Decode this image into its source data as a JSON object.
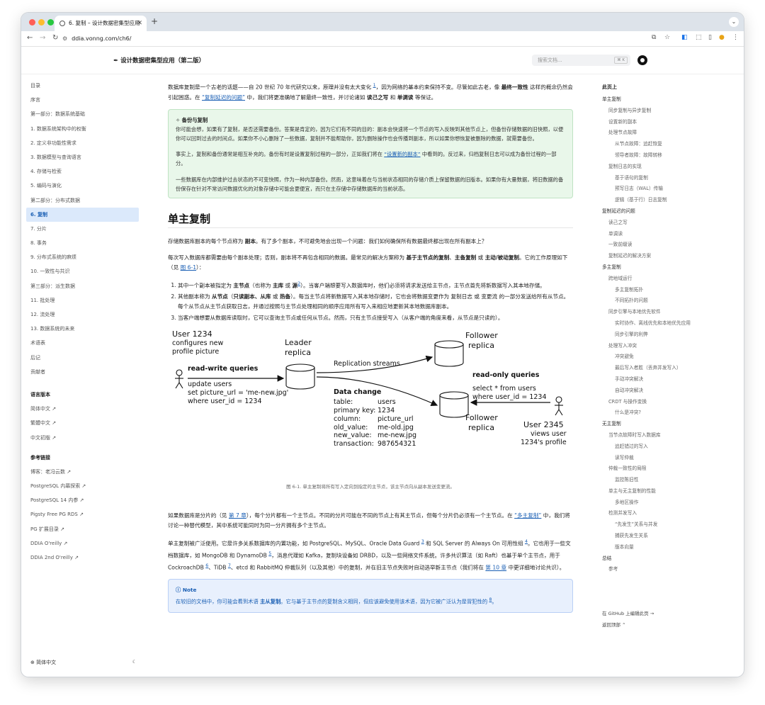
{
  "browser": {
    "tab_title": "6. 复制 – 设计数据密集型应用",
    "url": "ddia.vonng.com/ch6/",
    "colors": {
      "close": "#ff5f57",
      "minimize": "#febc2e",
      "maximize": "#28c840"
    }
  },
  "site": {
    "logo": "设计数据密集型应用（第二版）",
    "search_placeholder": "搜索文档...",
    "search_shortcut": "⌘ K"
  },
  "sidebar": {
    "items": [
      {
        "label": "目录"
      },
      {
        "label": "序言"
      },
      {
        "label": "第一部分：数据系统基础"
      },
      {
        "label": "1. 数据系统架构中的权衡"
      },
      {
        "label": "2. 定义非功能性需求"
      },
      {
        "label": "3. 数据模型与查询语言"
      },
      {
        "label": "4. 存储与检索"
      },
      {
        "label": "5. 编码与演化"
      },
      {
        "label": "第二部分：分布式数据"
      },
      {
        "label": "6. 复制",
        "active": true
      },
      {
        "label": "7. 分片"
      },
      {
        "label": "8. 事务"
      },
      {
        "label": "9. 分布式系统的麻烦"
      },
      {
        "label": "10. 一致性与共识"
      },
      {
        "label": "第三部分：派生数据"
      },
      {
        "label": "11. 批处理"
      },
      {
        "label": "12. 流处理"
      },
      {
        "label": "13. 数据系统的未来"
      },
      {
        "label": "术语表"
      },
      {
        "label": "后记"
      },
      {
        "label": "贡献者"
      }
    ],
    "lang_heading": "语言版本",
    "lang_items": [
      {
        "label": "简体中文 ↗"
      },
      {
        "label": "繁體中文 ↗"
      },
      {
        "label": "中文初版 ↗"
      }
    ],
    "links_heading": "参考链接",
    "link_items": [
      {
        "label": "博客：老冯云数 ↗"
      },
      {
        "label": "PostgreSQL 内幕探索 ↗"
      },
      {
        "label": "PostgreSQL 14 内参 ↗"
      },
      {
        "label": "Pigsty Free PG RDS ↗"
      },
      {
        "label": "PG 扩展目录 ↗"
      },
      {
        "label": "DDIA O'reilly ↗"
      },
      {
        "label": "DDIA 2nd O'reilly ↗"
      }
    ],
    "footer_lang": "⊕ 简体中文",
    "footer_theme": "☾"
  },
  "article": {
    "intro": {
      "t1": "数据库复制是一个古老的话题——自 20 世纪 70 年代研究以来，原理并没有太大变化 ",
      "s1": "1",
      "t2": "，因为网络的基本约束保持不变。尽管如此古老，像 ",
      "b1": "最终一致性",
      "t3": " 这样的概念仍然会引起困惑。在 ",
      "link": "“复制延迟的问题”",
      "t4": " 中，我们将更准确地了解最终一致性，并讨论诸如 ",
      "b2": "读己之写",
      "t5": " 和 ",
      "b3": "单调读",
      "t6": " 等保证。"
    },
    "tip": {
      "title": "✧ 备份与复制",
      "p1": "你可能会想，如果有了复制，是否还需要备份。答案是肯定的，因为它们有不同的目的：副本会快速将一个节点的写入反映到其他节点上，但备份存储数据的旧快照，以便你可以回到过去的时间点。如果你不小心删除了一些数据，复制并不能帮助你，因为删除操作也会传播到副本，所以如果你想恢复被删除的数据，就需要备份。",
      "p2a": "事实上，复制和备份通常是相互补充的。备份有时是设置复制过程的一部分，正如我们将在 ",
      "p2link": "“设置新的副本”",
      "p2b": " 中看到的。反过来，归档复制日志可以成为备份过程的一部分。",
      "p3": "一些数据库在内部维护过去状态的不可变快照，作为一种内部备份。然而，这意味着在与当前状态相同的存储介质上保留数据的旧版本。如果你有大量数据，将旧数据的备份保存在针对不常访问数据优化的对象存储中可能会更便宜，而只在主存储中存储数据库的当前状态。"
    },
    "h2": "单主复制",
    "p1": {
      "t1": "存储数据库副本的每个节点称为 ",
      "b1": "副本",
      "t2": "。有了多个副本，不可避免地会出现一个问题：我们如何确保所有数据最终都出现在所有副本上？"
    },
    "p2": {
      "t1": "每次写入数据库都需要由每个副本处理；否则，副本将不再包含相同的数据。最常见的解决方案称为 ",
      "b1": "基于主节点的复制",
      "t2": "、",
      "b2": "主备复制",
      "t3": " 或 ",
      "b3": "主动/被动复制",
      "t4": "。它的工作原理如下（见 ",
      "link": "图 6-1",
      "t5": "）："
    },
    "list": [
      {
        "t1": "其中一个副本被指定为 ",
        "b1": "主节点",
        "t2": "（也称为 ",
        "b2": "主库",
        "t3": " 或 ",
        "b3": "源",
        "s": "2",
        "t4": "）。当客户端想要写入数据库时，他们必须将请求发送给主节点，主节点首先将新数据写入其本地存储。"
      },
      {
        "t1": "其他副本称为 ",
        "b1": "从节点",
        "t2": "（",
        "b2": "只读副本、从库",
        "t3": " 或 ",
        "b3": "热备",
        "s": "",
        "t4": "）。每当主节点将新数据写入其本地存储时，它也会将数据变更作为 复制日志 或 变更流 的一部分发送给所有从节点。每个从节点从主节点获取日志，并通过按照与主节点处理相同的顺序应用所有写入来相应地更新其本地数据库副本。"
      },
      {
        "t1": "当客户端想要从数据库读取时，它可以查询主节点或任何从节点。然而，只有主节点接受写入（从客户端的角度来看，从节点是只读的）。",
        "b1": "",
        "t2": "",
        "b2": "",
        "t3": "",
        "b3": "",
        "s": "",
        "t4": ""
      }
    ],
    "figure": {
      "user1_name": "User 1234",
      "user1_desc1": "configures new",
      "user1_desc2": "profile picture",
      "rw_label": "read-write queries",
      "q1_l1": "update users",
      "q1_l2": "set picture_url = 'me-new.jpg'",
      "q1_l3": "where user_id = 1234",
      "leader1": "Leader",
      "leader2": "replica",
      "repl_streams": "Replication streams",
      "follower1a": "Follower",
      "follower1b": "replica",
      "follower2a": "Follower",
      "follower2b": "replica",
      "dc_title": "Data change",
      "dc_rows": [
        {
          "k": "table:",
          "v": "users"
        },
        {
          "k": "primary key:",
          "v": "1234"
        },
        {
          "k": "column:",
          "v": "picture_url"
        },
        {
          "k": "old_value:",
          "v": "me-old.jpg"
        },
        {
          "k": "new_value:",
          "v": "me-new.jpg"
        },
        {
          "k": "transaction:",
          "v": "987654321"
        }
      ],
      "ro_label": "read-only queries",
      "q2_l1": "select * from users",
      "q2_l2": "where user_id = 1234",
      "user2_name": "User 2345",
      "user2_desc1": "views user",
      "user2_desc2": "1234's profile",
      "caption": "图 6-1. 单主复制将所有写入定向到指定的主节点，该主节点向从副本发送变更流。"
    },
    "p3": {
      "t1": "如果数据库是分片的（见 ",
      "link1": "第 7 章",
      "t2": "），每个分片都有一个主节点。不同的分片可能在不同的节点上有其主节点，但每个分片仍必须有一个主节点。在 ",
      "link2": "“多主复制”",
      "t3": " 中，我们将讨论一种替代模型，其中系统可能同时为同一分片拥有多个主节点。"
    },
    "p4": {
      "t1": "单主复制被广泛使用。它是许多关系数据库的内置功能，如 PostgreSQL、MySQL、Oracle Data Guard ",
      "s1": "3",
      "t2": " 和 SQL Server 的 Always On 可用性组 ",
      "s2": "4",
      "t3": "。它也用于一些文档数据库，如 MongoDB 和 DynamoDB ",
      "s3": "5",
      "t4": "，消息代理如 Kafka，复制块设备如 DRBD，以及一些网络文件系统。许多共识算法（如 Raft）也基于单个主节点，用于 CockroachDB ",
      "s4": "6",
      "t5": "、TiDB ",
      "s5": "7",
      "t6": "、etcd 和 RabbitMQ 仲裁队列（以及其他）中的复制，并在旧主节点失败时自动选举新主节点（我们将在 ",
      "link": "第 10 章",
      "t7": " 中更详细地讨论共识）。"
    },
    "note": {
      "title": "ⓘ Note",
      "t1": "在较旧的文档中，你可能会看到术语 ",
      "b1": "主从复制",
      "t2": "。它与基于主节点的复制含义相同，但应该避免使用该术语，因为它被广泛认为是冒犯性的 ",
      "s": "8",
      "t3": "。"
    }
  },
  "toc": {
    "title": "此页上",
    "items": [
      {
        "label": "单主复制",
        "level": 1
      },
      {
        "label": "同步复制与异步复制",
        "level": 2
      },
      {
        "label": "设置新的副本",
        "level": 2
      },
      {
        "label": "处理节点故障",
        "level": 2
      },
      {
        "label": "从节点故障：追赶恢复",
        "level": 3
      },
      {
        "label": "领导者故障：故障转移",
        "level": 3
      },
      {
        "label": "复制日志的实现",
        "level": 2
      },
      {
        "label": "基于语句的复制",
        "level": 3
      },
      {
        "label": "预写日志（WAL）传输",
        "level": 3
      },
      {
        "label": "逻辑（基于行）日志复制",
        "level": 3
      },
      {
        "label": "复制延迟的问题",
        "level": 1
      },
      {
        "label": "读己之写",
        "level": 2
      },
      {
        "label": "单调读",
        "level": 2
      },
      {
        "label": "一致前缀读",
        "level": 2
      },
      {
        "label": "复制延迟的解决方案",
        "level": 2
      },
      {
        "label": "多主复制",
        "level": 1
      },
      {
        "label": "跨地域运行",
        "level": 2
      },
      {
        "label": "多主复制拓扑",
        "level": 3
      },
      {
        "label": "不同拓扑的问题",
        "level": 3
      },
      {
        "label": "同步引擎与本地优先软件",
        "level": 2
      },
      {
        "label": "实时协作、离线优先和本地优先应用",
        "level": 3
      },
      {
        "label": "同步引擎的利弊",
        "level": 3
      },
      {
        "label": "处理写入冲突",
        "level": 2
      },
      {
        "label": "冲突避免",
        "level": 3
      },
      {
        "label": "最后写入者胜（丢弃并发写入）",
        "level": 3
      },
      {
        "label": "手动冲突解决",
        "level": 3
      },
      {
        "label": "自动冲突解决",
        "level": 3
      },
      {
        "label": "CRDT 与操作变换",
        "level": 2
      },
      {
        "label": "什么是冲突?",
        "level": 3
      },
      {
        "label": "无主复制",
        "level": 1
      },
      {
        "label": "当节点故障时写入数据库",
        "level": 2
      },
      {
        "label": "追赶错过的写入",
        "level": 3
      },
      {
        "label": "读写仲裁",
        "level": 3
      },
      {
        "label": "仲裁一致性的局限",
        "level": 2
      },
      {
        "label": "监控陈旧性",
        "level": 3
      },
      {
        "label": "单主与无主复制的性能",
        "level": 2
      },
      {
        "label": "多地区操作",
        "level": 3
      },
      {
        "label": "检测并发写入",
        "level": 2
      },
      {
        "label": "“先发生”关系与并发",
        "level": 3
      },
      {
        "label": "捕获先发生关系",
        "level": 3
      },
      {
        "label": "版本向量",
        "level": 3
      },
      {
        "label": "总结",
        "level": 1
      },
      {
        "label": "参考",
        "level": 2
      }
    ],
    "edit_link": "在 GitHub 上编辑此页 →",
    "back_top": "返回顶部 ⌃"
  }
}
